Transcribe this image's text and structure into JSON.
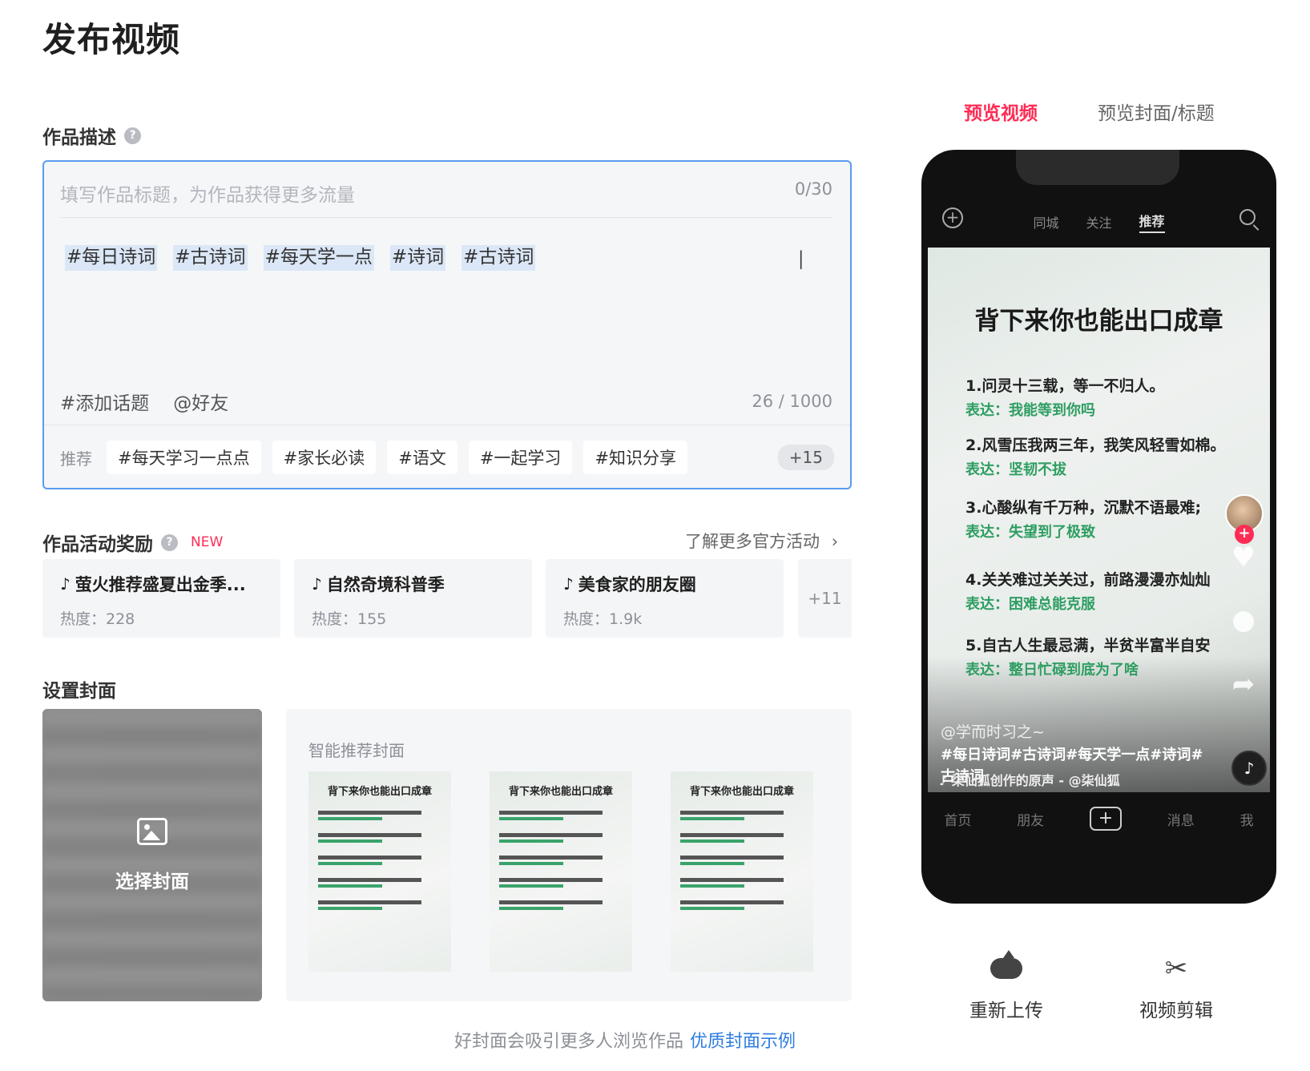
{
  "page_title": "发布视频",
  "description": {
    "label": "作品描述",
    "help_icon": "question-circle-icon",
    "title_placeholder": "填写作品标题，为作品获得更多流量",
    "title_count": "0/30",
    "tags": [
      "#每日诗词",
      "#古诗词",
      "#每天学一点",
      "#诗词",
      "#古诗词"
    ],
    "add_topic": "#添加话题",
    "mention": "@好友",
    "body_count": "26 / 1000",
    "recommend_label": "推荐",
    "recommend_tags": [
      "#每天学习一点点",
      "#家长必读",
      "#语文",
      "#一起学习",
      "#知识分享"
    ],
    "recommend_more": "+15"
  },
  "activity": {
    "label": "作品活动奖励",
    "badge": "NEW",
    "more_link": "了解更多官方活动",
    "cards": [
      {
        "name": "萤火推荐盛夏出金季...",
        "heat": "热度：228"
      },
      {
        "name": "自然奇境科普季",
        "heat": "热度：155"
      },
      {
        "name": "美食家的朋友圈",
        "heat": "热度：1.9k"
      }
    ],
    "more": "+11"
  },
  "cover": {
    "label": "设置封面",
    "select_label": "选择封面",
    "smart_title": "智能推荐封面",
    "thumb_title": "背下来你也能出口成章",
    "hint": "好封面会吸引更多人浏览作品",
    "hint_link": "优质封面示例"
  },
  "preview": {
    "tab_video": "预览视频",
    "tab_cover": "预览封面/标题",
    "top_tabs": [
      "同城",
      "关注",
      "推荐"
    ],
    "video_title": "背下来你也能出口成章",
    "poems": [
      {
        "line": "1.问灵十三载，等一不归人。",
        "meaning": "表达：我能等到你吗"
      },
      {
        "line": "2.风雪压我两三年，我笑风轻雪如棉。",
        "meaning": "表达：坚韧不拔"
      },
      {
        "line": "3.心酸纵有千万种，沉默不语最难;",
        "meaning": "表达：失望到了极致"
      },
      {
        "line": "4.关关难过关关过，前路漫漫亦灿灿",
        "meaning": "表达：困难总能克服"
      },
      {
        "line": "5.自古人生最忌满，半贫半富半自安",
        "meaning": "表达：整日忙碌到底为了啥"
      }
    ],
    "author": "@学而时习之~",
    "caption": "#每日诗词#古诗词#每天学一点#诗词#古诗词",
    "music": "柒仙狐创作的原声 - @柒仙狐",
    "nav": [
      "首页",
      "朋友",
      "消息",
      "我"
    ]
  },
  "actions": {
    "reupload": "重新上传",
    "edit": "视频剪辑"
  }
}
